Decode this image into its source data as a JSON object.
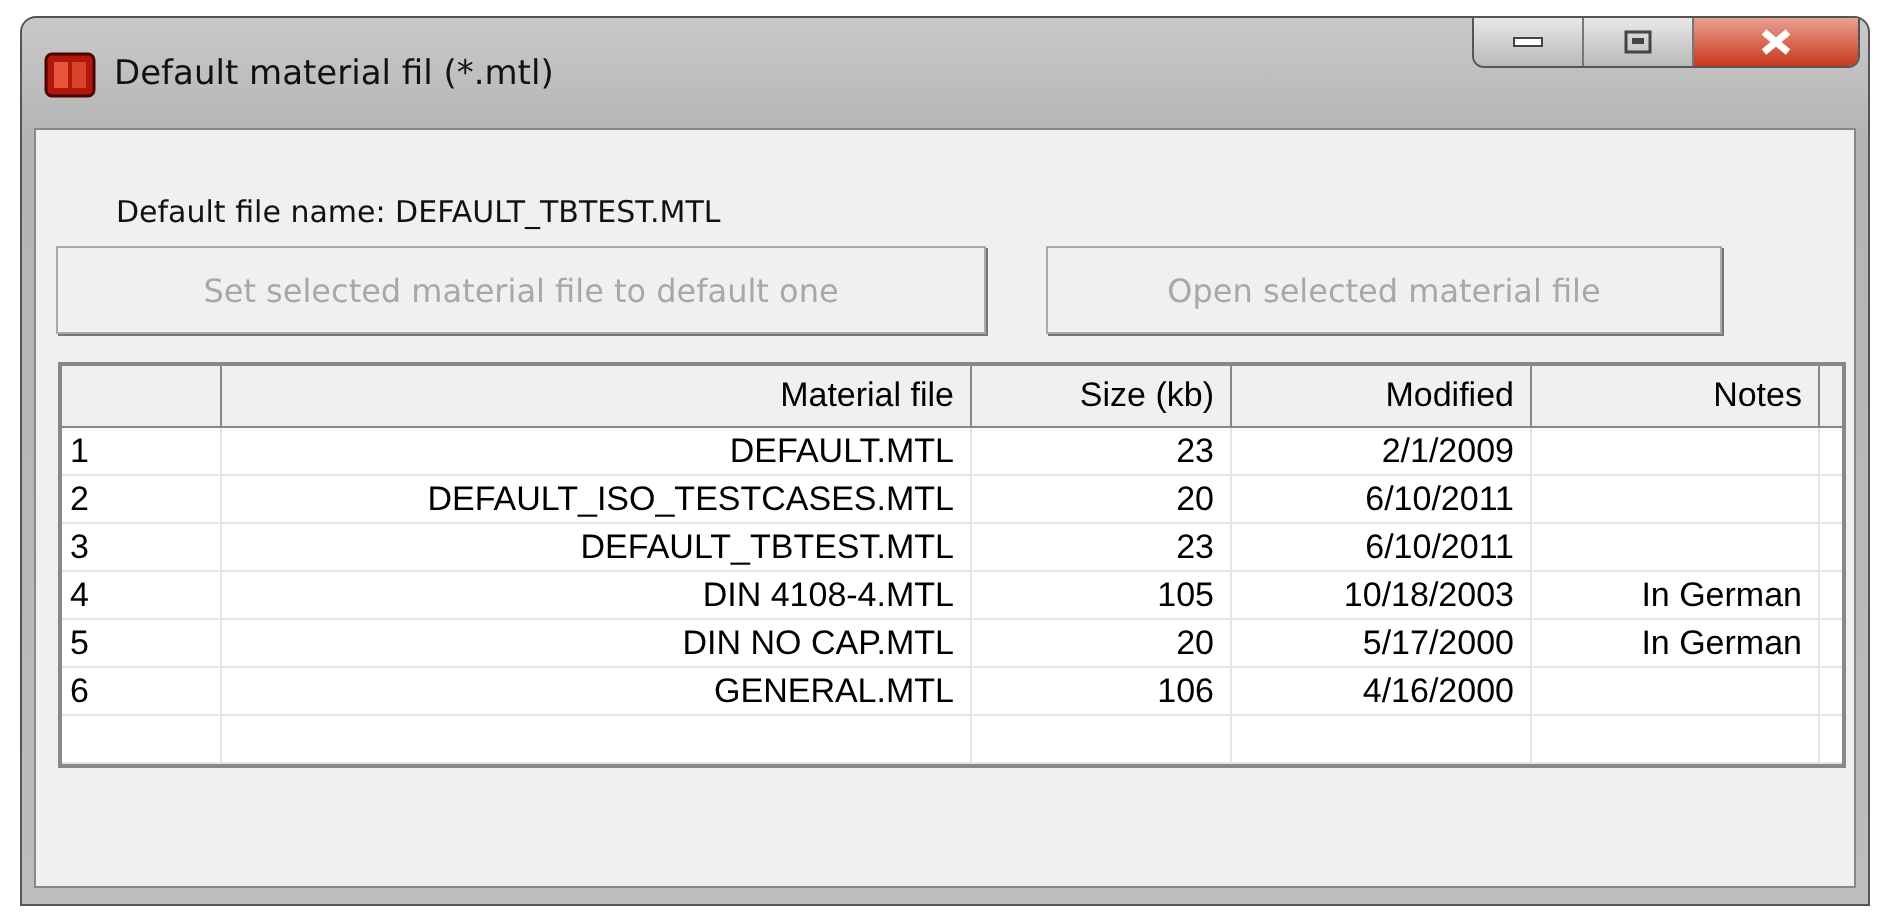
{
  "window": {
    "title": "Default material fil (*.mtl)"
  },
  "default_file": "Default file name: DEFAULT_TBTEST.MTL",
  "buttons": [
    {
      "label": "Set selected material file to default one",
      "disabled": true
    },
    {
      "label": "Open selected material file",
      "disabled": true
    }
  ],
  "table": {
    "columns": [
      "Material file",
      "Size (kb)",
      "Modified",
      "Notes"
    ],
    "rows": [
      {
        "number": "1",
        "cells": [
          "DEFAULT.MTL",
          "23",
          "2/1/2009",
          ""
        ]
      },
      {
        "number": "2",
        "cells": [
          "DEFAULT_ISO_TESTCASES.MTL",
          "20",
          "6/10/2011",
          ""
        ]
      },
      {
        "number": "3",
        "cells": [
          "DEFAULT_TBTEST.MTL",
          "23",
          "6/10/2011",
          ""
        ]
      },
      {
        "number": "4",
        "cells": [
          "DIN 4108-4.MTL",
          "105",
          "10/18/2003",
          "In German"
        ]
      },
      {
        "number": "5",
        "cells": [
          "DIN NO CAP.MTL",
          "20",
          "5/17/2000",
          "In German"
        ]
      },
      {
        "number": "6",
        "cells": [
          "GENERAL.MTL",
          "106",
          "4/16/2000",
          ""
        ]
      }
    ]
  }
}
